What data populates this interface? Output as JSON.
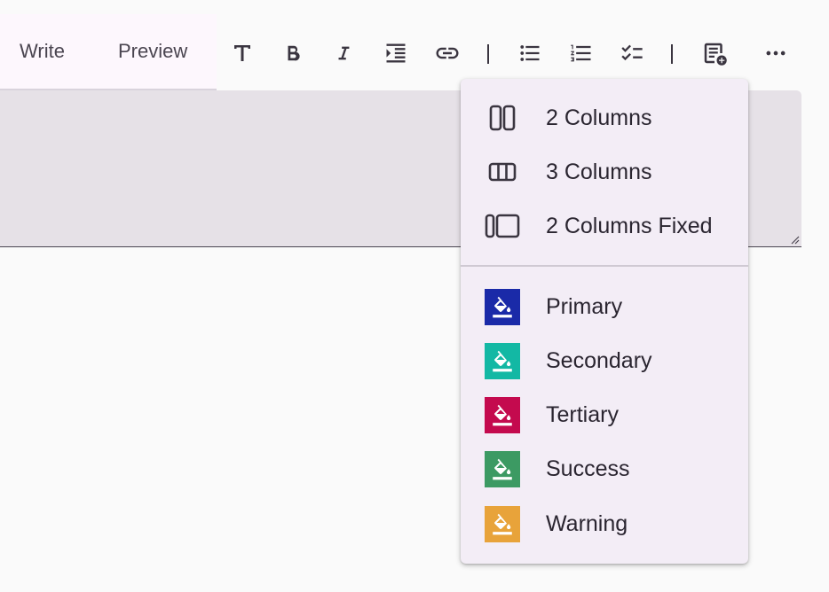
{
  "tabs": {
    "write_label": "Write",
    "preview_label": "Preview"
  },
  "toolbar": {
    "buttons": [
      {
        "name": "heading",
        "icon": "heading-icon"
      },
      {
        "name": "bold",
        "icon": "bold-icon"
      },
      {
        "name": "italic",
        "icon": "italic-icon"
      },
      {
        "name": "indent",
        "icon": "indent-icon"
      },
      {
        "name": "link",
        "icon": "link-icon"
      },
      {
        "name": "bulleted-list",
        "icon": "bulleted-list-icon"
      },
      {
        "name": "numbered-list",
        "icon": "numbered-list-icon"
      },
      {
        "name": "task-list",
        "icon": "checklist-icon"
      },
      {
        "name": "insert-block",
        "icon": "note-add-icon"
      },
      {
        "name": "more",
        "icon": "more-horizontal-icon"
      }
    ]
  },
  "menu": {
    "layout_items": [
      {
        "label": "2 Columns",
        "icon": "two-columns-icon"
      },
      {
        "label": "3 Columns",
        "icon": "three-columns-icon"
      },
      {
        "label": "2 Columns Fixed",
        "icon": "two-columns-fixed-icon"
      }
    ],
    "color_items": [
      {
        "label": "Primary",
        "icon": "paint-bucket-icon",
        "color": "#1a2aa8"
      },
      {
        "label": "Secondary",
        "icon": "paint-bucket-icon",
        "color": "#13b8a4"
      },
      {
        "label": "Tertiary",
        "icon": "paint-bucket-icon",
        "color": "#c40a4e"
      },
      {
        "label": "Success",
        "icon": "paint-bucket-icon",
        "color": "#3c9a63"
      },
      {
        "label": "Warning",
        "icon": "paint-bucket-icon",
        "color": "#e8a33a"
      }
    ]
  }
}
